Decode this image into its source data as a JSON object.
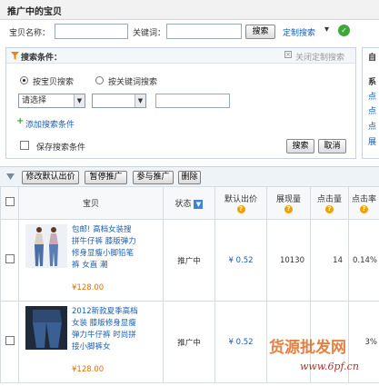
{
  "header": {
    "title": "推广中的宝贝"
  },
  "search": {
    "item_name_label": "宝贝名称：",
    "keyword_label": "关键词：",
    "search_button": "搜索",
    "custom_search_link": "定制搜索",
    "dropdown_arrow": "▾"
  },
  "condition_panel": {
    "title": "搜索条件：",
    "close_link": "关闭定制搜索",
    "radio_item": "按宝贝搜索",
    "radio_keyword": "按关键词搜索",
    "select_placeholder": "请选择",
    "add_condition_link": "添加搜索条件",
    "save_condition_label": "保存搜索条件",
    "search_button": "搜索",
    "cancel_button": "取消"
  },
  "right_panel": {
    "title": "自",
    "subtitle": "系",
    "links": [
      "点",
      "点",
      "点",
      "展"
    ]
  },
  "toolbar": {
    "buttons": [
      "修改默认出价",
      "暂停推广",
      "参与推广",
      "删除"
    ]
  },
  "table": {
    "headers": [
      "宝贝",
      "状态",
      "默认出价",
      "展现量",
      "点击量",
      "点击率"
    ],
    "rows": [
      {
        "title_lines": [
          "包邮! 高档女装搜",
          "拼牛仔裤 膝版弹力",
          "修身显瘦小脚铅笔",
          "裤 女直 潮"
        ],
        "price": "¥128.00",
        "status": "推广中",
        "bid": "¥ 0.52",
        "impressions": "10130",
        "clicks": "14",
        "ctr": "0.14%"
      },
      {
        "title_lines": [
          "2012新款夏季高档",
          "女装 膝版修身显瘦",
          "弹力牛仔裤 时尚拼",
          "接小脚裤女"
        ],
        "price": "¥128.00",
        "status": "推广中",
        "bid": "¥ 0.52",
        "impressions": "",
        "clicks": "",
        "ctr": "3%"
      }
    ]
  },
  "watermark": {
    "text": "货源批发网",
    "url": "www.6pf.cn"
  }
}
